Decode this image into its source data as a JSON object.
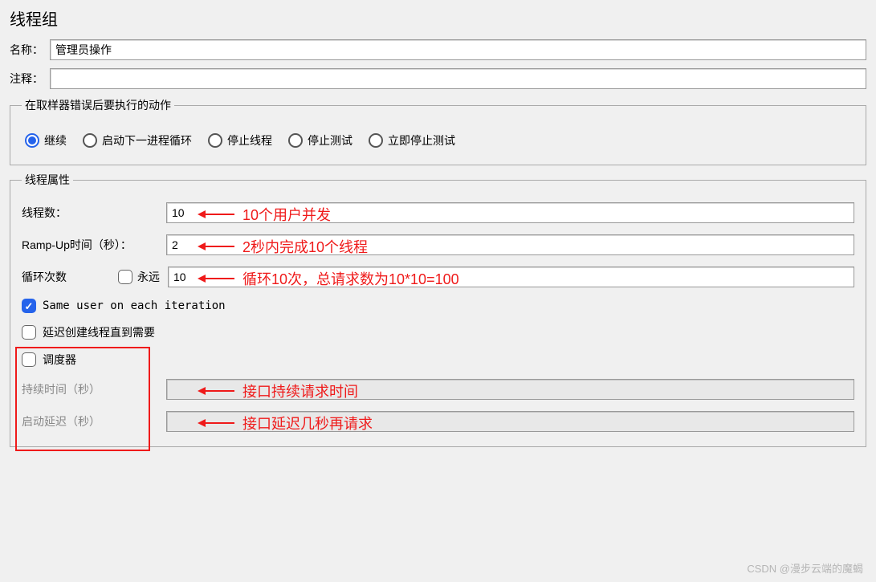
{
  "title": "线程组",
  "fields": {
    "name_label": "名称：",
    "name_value": "管理员操作",
    "comment_label": "注释：",
    "comment_value": ""
  },
  "error_action": {
    "legend": "在取样器错误后要执行的动作",
    "options": [
      "继续",
      "启动下一进程循环",
      "停止线程",
      "停止测试",
      "立即停止测试"
    ],
    "selected": 0
  },
  "thread_props": {
    "legend": "线程属性",
    "threads_label": "线程数：",
    "threads_value": "10",
    "rampup_label": "Ramp-Up时间（秒）：",
    "rampup_value": "2",
    "loop_label": "循环次数",
    "forever_label": "永远",
    "loop_value": "10",
    "same_user_label": "Same user on each iteration",
    "delay_create_label": "延迟创建线程直到需要",
    "scheduler_label": "调度器",
    "duration_label": "持续时间（秒）",
    "duration_value": "",
    "startup_delay_label": "启动延迟（秒）",
    "startup_delay_value": ""
  },
  "annotations": {
    "threads": "10个用户并发",
    "rampup": "2秒内完成10个线程",
    "loop": "循环10次，总请求数为10*10=100",
    "duration": "接口持续请求时间",
    "startup": "接口延迟几秒再请求"
  },
  "watermark": "CSDN @漫步云端的魔蝎"
}
